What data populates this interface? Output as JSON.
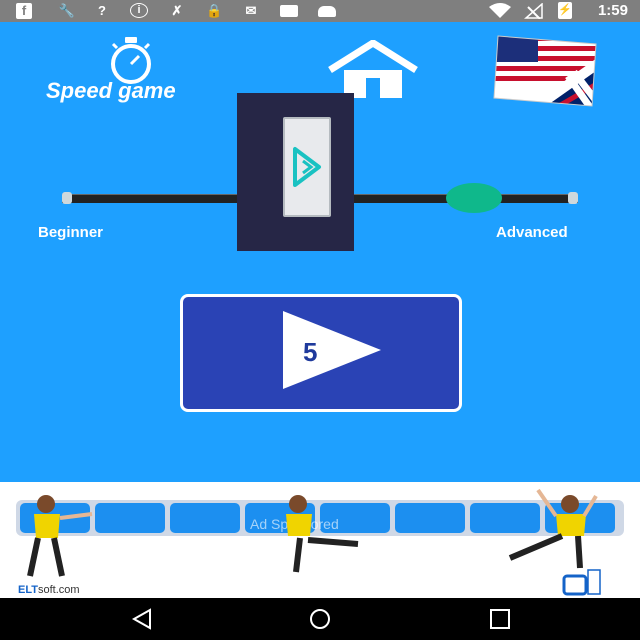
{
  "status_bar": {
    "icons": [
      "facebook-icon",
      "wrench-icon",
      "question-icon",
      "info-icon",
      "tools-icon",
      "lock-icon",
      "mail-icon",
      "briefcase-icon",
      "android-icon",
      "wifi-icon",
      "no-signal-icon",
      "battery-icon"
    ],
    "time": "1:59"
  },
  "app": {
    "title": "Speed game",
    "background": "#1ea0ff",
    "icons": {
      "timer": "stopwatch-icon",
      "home": "home-icon",
      "language": "us-uk-flag-icon"
    }
  },
  "level_slider": {
    "min_label": "Beginner",
    "max_label": "Advanced",
    "value": 0.8
  },
  "play_button": {
    "count": "5",
    "icon": "play-icon"
  },
  "ad_banner": {
    "text": "Ad Sponsored",
    "brand_prefix": "ELT",
    "brand_suffix": "soft.com",
    "logo": "eltsoft-logo"
  },
  "nav_bar": {
    "buttons": [
      "back-icon",
      "home-circle-icon",
      "recents-icon"
    ]
  }
}
